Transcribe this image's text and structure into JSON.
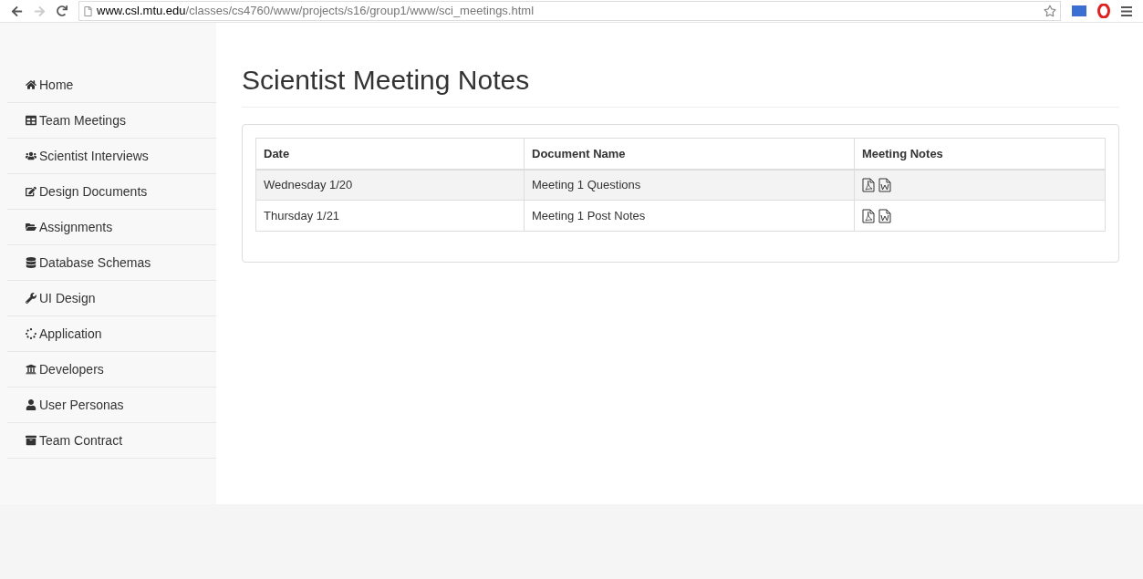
{
  "browser": {
    "url_host": "www.csl.mtu.edu",
    "url_path": "/classes/cs4760/www/projects/s16/group1/www/sci_meetings.html"
  },
  "sidebar": {
    "items": [
      {
        "label": "Home"
      },
      {
        "label": "Team Meetings"
      },
      {
        "label": "Scientist Interviews"
      },
      {
        "label": "Design Documents"
      },
      {
        "label": "Assignments"
      },
      {
        "label": "Database Schemas"
      },
      {
        "label": "UI Design"
      },
      {
        "label": "Application"
      },
      {
        "label": "Developers"
      },
      {
        "label": "User Personas"
      },
      {
        "label": "Team Contract"
      }
    ]
  },
  "page": {
    "title": "Scientist Meeting Notes"
  },
  "table": {
    "columns": [
      "Date",
      "Document Name",
      "Meeting Notes"
    ],
    "rows": [
      {
        "date": "Wednesday 1/20",
        "document": "Meeting 1 Questions",
        "striped": true
      },
      {
        "date": "Thursday 1/21",
        "document": "Meeting 1 Post Notes",
        "striped": false
      }
    ]
  }
}
